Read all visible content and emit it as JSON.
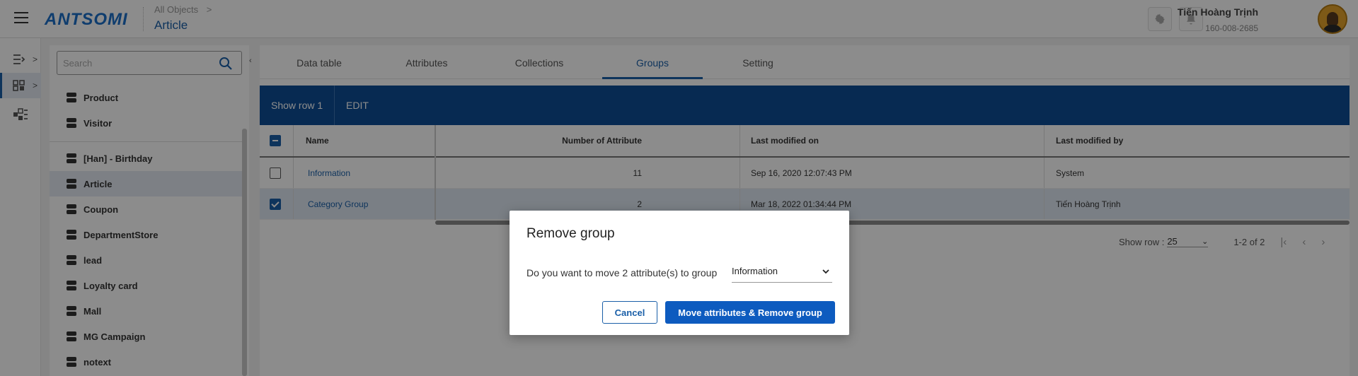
{
  "header": {
    "logo": "ANTSOMI",
    "breadcrumb": "All Objects",
    "breadcrumb_chevron": ">",
    "title": "Article",
    "settings_icon": "gear-icon",
    "notification_icon": "bell-icon",
    "user_name": "Tiến Hoàng Trịnh",
    "user_id": "160-008-2685"
  },
  "rail": {
    "items": [
      {
        "icon": "import-icon",
        "chevron": ">"
      },
      {
        "icon": "objects-icon",
        "chevron": ">"
      },
      {
        "icon": "cubes-icon"
      }
    ]
  },
  "sidebar": {
    "search_placeholder": "Search",
    "collapse_glyph": "‹",
    "items": [
      {
        "label": "Product"
      },
      {
        "label": "Visitor"
      },
      {
        "label": "[Han] - Birthday"
      },
      {
        "label": "Article"
      },
      {
        "label": "Coupon"
      },
      {
        "label": "DepartmentStore"
      },
      {
        "label": "lead"
      },
      {
        "label": "Loyalty card"
      },
      {
        "label": "Mall"
      },
      {
        "label": "MG Campaign"
      },
      {
        "label": "notext"
      }
    ],
    "active_item": "Article"
  },
  "tabs": [
    {
      "label": "Data table"
    },
    {
      "label": "Attributes"
    },
    {
      "label": "Collections"
    },
    {
      "label": "Groups"
    },
    {
      "label": "Setting"
    }
  ],
  "active_tab": "Groups",
  "toolbar": {
    "show_row": "Show row 1",
    "edit": "EDIT"
  },
  "table": {
    "columns": [
      "Name",
      "Number of Attribute",
      "Last modified on",
      "Last modified by"
    ],
    "rows": [
      {
        "name": "Information",
        "count": "11",
        "modified_on": "Sep 16, 2020 12:07:43 PM",
        "modified_by": "System",
        "selected": false
      },
      {
        "name": "Category Group",
        "count": "2",
        "modified_on": "Mar 18, 2022 01:34:44 PM",
        "modified_by": "Tiến Hoàng Trịnh",
        "selected": true
      }
    ]
  },
  "pagination": {
    "show_row_label": "Show row :",
    "rows_per_page": "25",
    "range": "1-2 of 2"
  },
  "dialog": {
    "title": "Remove group",
    "message": "Do you want to move 2 attribute(s) to group",
    "selected_group": "Information",
    "cancel_label": "Cancel",
    "confirm_label": "Move attributes & Remove group"
  },
  "colors": {
    "primary": "#1a5fa8",
    "toolbar_bg": "#0e4e95",
    "confirm_bg": "#0d5bbf"
  }
}
